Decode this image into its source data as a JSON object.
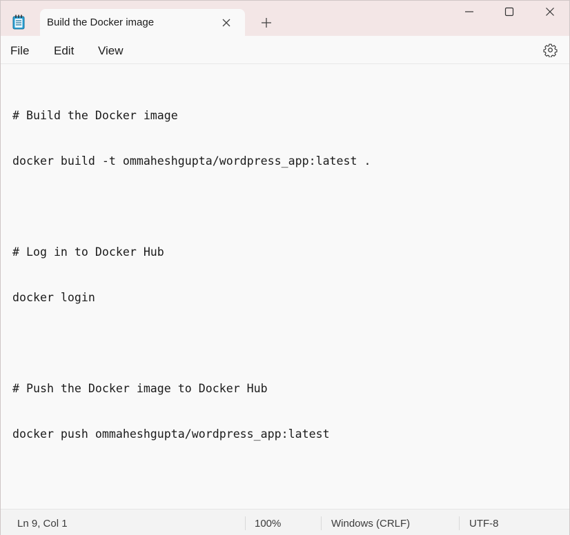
{
  "titlebar": {
    "app_icon": "notepad-icon",
    "tab_title": "Build the Docker image",
    "tab_close_icon": "close-icon",
    "new_tab_icon": "plus-icon",
    "minimize_icon": "minimize-icon",
    "maximize_icon": "maximize-icon",
    "close_icon": "close-icon"
  },
  "menubar": {
    "items": [
      {
        "label": "File"
      },
      {
        "label": "Edit"
      },
      {
        "label": "View"
      }
    ],
    "settings_icon": "gear-icon"
  },
  "editor": {
    "lines": [
      "# Build the Docker image",
      "docker build -t ommaheshgupta/wordpress_app:latest .",
      "",
      "# Log in to Docker Hub",
      "docker login",
      "",
      "# Push the Docker image to Docker Hub",
      "docker push ommaheshgupta/wordpress_app:latest"
    ]
  },
  "statusbar": {
    "position": "Ln 9, Col 1",
    "zoom": "100%",
    "line_ending": "Windows (CRLF)",
    "encoding": "UTF-8"
  },
  "colors": {
    "titlebar_bg": "#f3e6e6",
    "editor_bg": "#f9f9f9",
    "accent_icon": "#2aa3d8"
  }
}
